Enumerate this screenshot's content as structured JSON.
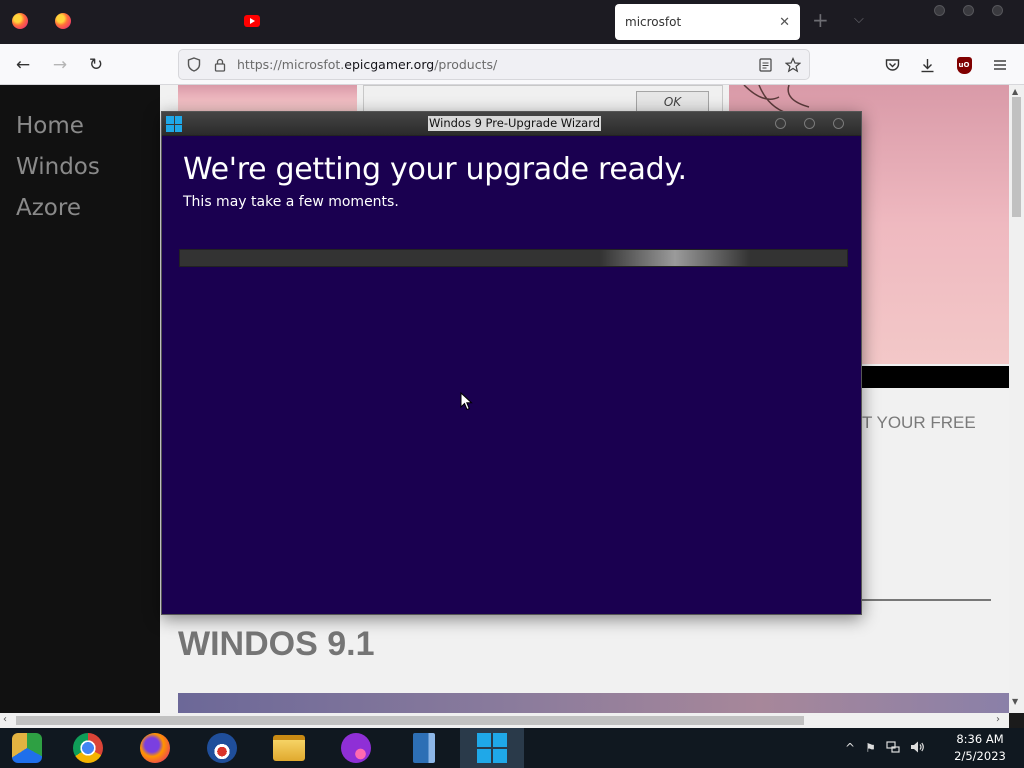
{
  "browser": {
    "active_tab": {
      "title": "microsfot",
      "close_glyph": "✕"
    },
    "new_tab_glyph": "+",
    "tab_list_glyph": "⌵",
    "pinned_tabs": [
      {
        "icon": "firefox-icon"
      },
      {
        "icon": "firefox-icon"
      },
      {
        "icon": "youtube-icon"
      }
    ],
    "nav": {
      "back_glyph": "←",
      "forward_glyph": "→",
      "reload_glyph": "↻"
    },
    "url": {
      "prefix": "https://microsfot.",
      "domain": "epicgamer.org",
      "path": "/products/"
    },
    "toolbar_icons": [
      "pocket-icon",
      "download-icon",
      "ublock-icon",
      "menu-icon"
    ],
    "ublock_label": "uO"
  },
  "webpage": {
    "sidebar": {
      "links": [
        "Home",
        "Windos",
        "Azore"
      ]
    },
    "dialog_ok_label": "OK",
    "promo_text": "T YOUR FREE",
    "product_title": "WINDOS 9.1"
  },
  "wizard": {
    "title": "Windos 9 Pre-Upgrade Wizard",
    "heading": "We're getting your upgrade ready.",
    "subheading": "This may take a few moments.",
    "accent_color": "#1a0050",
    "progress": {
      "indeterminate": true
    }
  },
  "taskbar": {
    "apps": [
      {
        "name": "chromium-icon"
      },
      {
        "name": "chrome-icon"
      },
      {
        "name": "firefox-icon"
      },
      {
        "name": "obama-logo-icon"
      },
      {
        "name": "file-explorer-icon"
      },
      {
        "name": "infinity-app-icon"
      },
      {
        "name": "book-app-icon"
      },
      {
        "name": "windows-logo-icon"
      }
    ],
    "tray_chevron": "^",
    "clock": {
      "time": "8:36 AM",
      "date": "2/5/2023"
    }
  }
}
